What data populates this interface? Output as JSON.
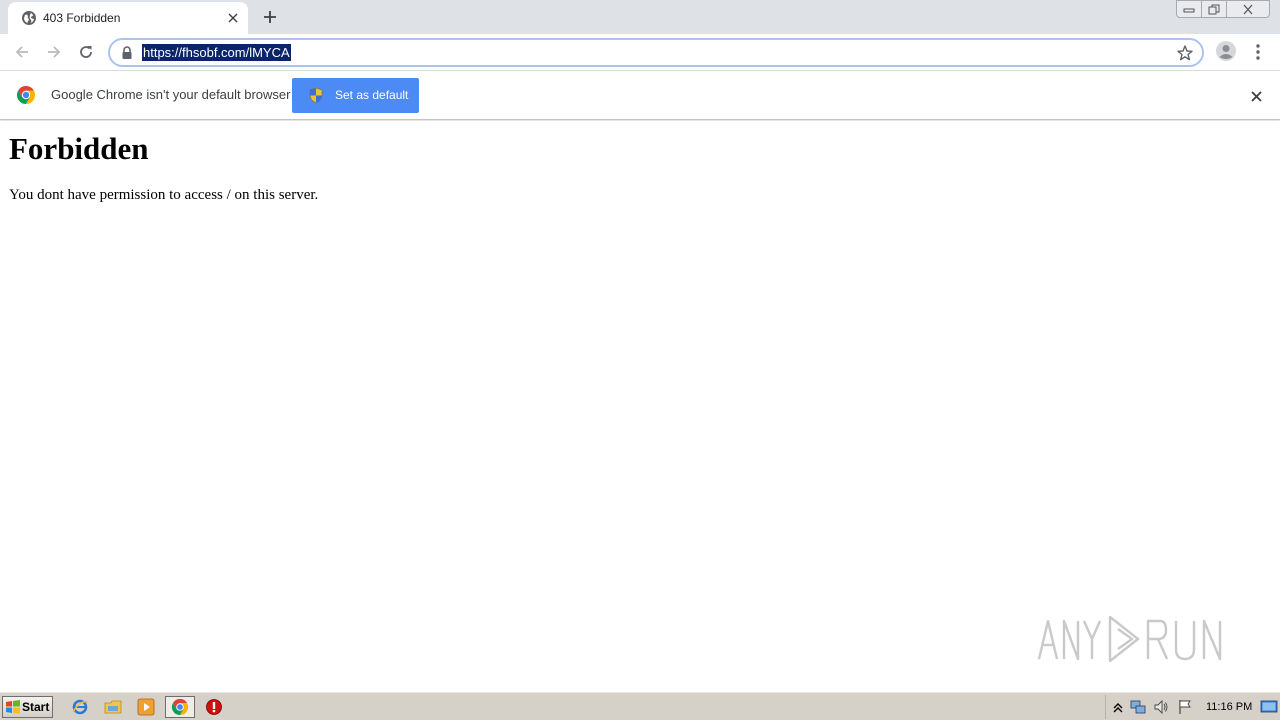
{
  "browser": {
    "tab": {
      "title": "403 Forbidden",
      "favicon": "globe-icon"
    },
    "address_bar": {
      "url": "https://fhsobf.com/lMYCA"
    },
    "infobar": {
      "message": "Google Chrome isn't your default browser",
      "button_label": "Set as default"
    }
  },
  "page": {
    "heading": "Forbidden",
    "message": "You dont have permission to access / on this server."
  },
  "watermark": {
    "text": "ANY RUN"
  },
  "taskbar": {
    "start_label": "Start",
    "apps": [
      "ie-icon",
      "explorer-icon",
      "media-player-icon",
      "chrome-icon",
      "stop-icon"
    ],
    "clock": "11:16 PM"
  },
  "colors": {
    "tabstrip": "#dee1e6",
    "url_selection": "#0a246a",
    "button_blue": "#4c8bf5",
    "taskbar": "#d5d0c8"
  }
}
